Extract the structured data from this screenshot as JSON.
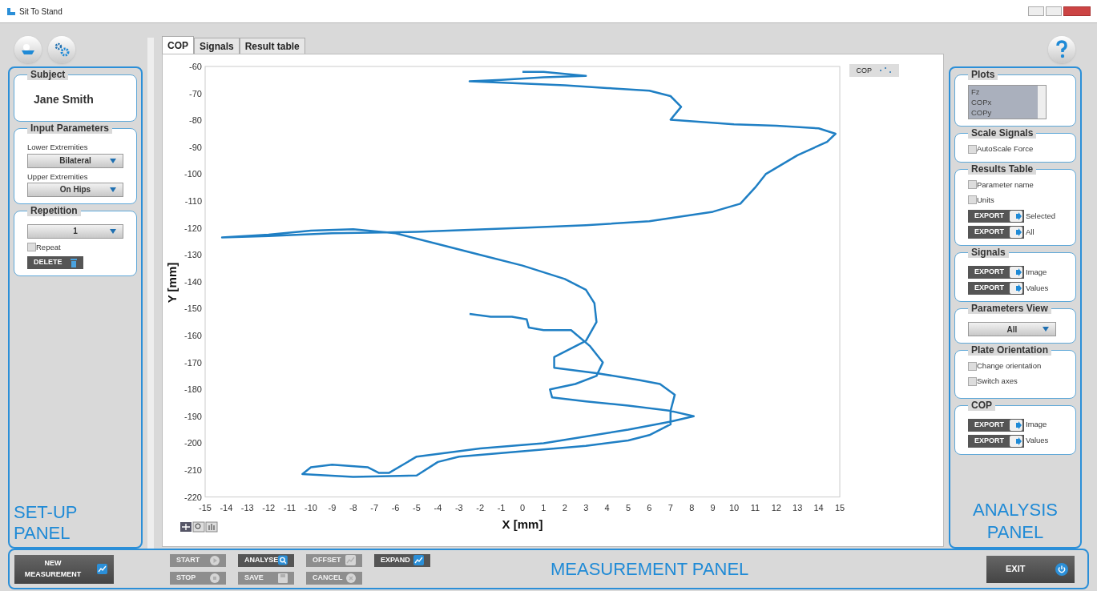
{
  "window": {
    "title": "Sit To Stand"
  },
  "setup_panel": {
    "label": "SET-UP PANEL",
    "subject": {
      "title": "Subject",
      "name": "Jane Smith"
    },
    "input_parameters": {
      "title": "Input Parameters",
      "fields": [
        {
          "label": "Lower Extremities",
          "value": "Bilateral"
        },
        {
          "label": "Upper Extremities",
          "value": "On Hips"
        }
      ]
    },
    "repetition": {
      "title": "Repetition",
      "value": "1",
      "repeat": {
        "label": "Repeat",
        "checked": false
      },
      "delete_button": "DELETE"
    }
  },
  "tabs": [
    {
      "label": "COP",
      "selected": true
    },
    {
      "label": "Signals",
      "selected": false
    },
    {
      "label": "Result table",
      "selected": false
    }
  ],
  "plot": {
    "chart_data": {
      "type": "line",
      "xlabel": "X [mm]",
      "ylabel": "Y [mm]",
      "xlim": [
        -15,
        15
      ],
      "ylim": [
        -220,
        -60
      ],
      "xticks": [
        -15,
        -14,
        -13,
        -12,
        -11,
        -10,
        -9,
        -8,
        -7,
        -6,
        -5,
        -4,
        -3,
        -2,
        -1,
        0,
        1,
        2,
        3,
        4,
        5,
        6,
        7,
        8,
        9,
        10,
        11,
        12,
        13,
        14,
        15
      ],
      "yticks": [
        -60,
        -70,
        -80,
        -90,
        -100,
        -110,
        -120,
        -130,
        -140,
        -150,
        -160,
        -170,
        -180,
        -190,
        -200,
        -210,
        -220
      ],
      "x": [
        -2.5,
        -1.5,
        -0.5,
        0.2,
        0.3,
        1,
        2.3,
        3.2,
        3.8,
        3.5,
        2.5,
        1.3,
        1.4,
        3,
        5,
        7,
        8.1,
        7,
        5,
        3,
        1,
        -2,
        -5,
        -6.3,
        -6.8,
        -7.3,
        -9,
        -10,
        -10.4,
        -8,
        -5,
        -4,
        -3,
        0,
        3,
        5,
        6,
        7,
        7,
        7.2,
        6.5,
        5.5,
        3.5,
        1.5,
        1.5,
        3,
        3.5,
        3.4,
        3,
        2,
        0,
        -2,
        -4,
        -6,
        -8,
        -10,
        -12,
        -14.2,
        -12,
        -9,
        -5,
        0,
        3,
        6,
        9,
        10.3,
        11,
        11.5,
        13,
        14.4,
        14.8,
        14,
        12,
        10,
        7,
        7.5,
        7,
        6,
        4,
        2,
        -2.5,
        -1,
        1,
        3,
        1,
        0
      ],
      "series": [
        {
          "name": "COP",
          "color": "#1f7fc4",
          "values": [
            -152,
            -153,
            -153,
            -154,
            -157,
            -158,
            -158,
            -164,
            -170,
            -175,
            -178,
            -180,
            -183,
            -184.5,
            -186,
            -188,
            -190,
            -192,
            -195,
            -197.5,
            -200,
            -202,
            -205,
            -211,
            -211,
            -209,
            -208,
            -209,
            -211.5,
            -212.5,
            -212,
            -207,
            -205,
            -203,
            -201,
            -199,
            -197,
            -193,
            -188,
            -182,
            -178,
            -176.5,
            -174,
            -172,
            -168,
            -162,
            -155,
            -148,
            -143,
            -139,
            -134,
            -130,
            -126,
            -122,
            -120.5,
            -121,
            -122.5,
            -123.5,
            -123,
            -122,
            -121.5,
            -120,
            -119,
            -117.5,
            -114,
            -111,
            -105,
            -100,
            -93,
            -88,
            -85,
            -83,
            -82,
            -81.5,
            -79.8,
            -75,
            -71,
            -69,
            -68,
            -67,
            -65.5,
            -65,
            -64,
            -63.5,
            -62,
            -62
          ]
        }
      ]
    }
  },
  "analysis_panel": {
    "label": "ANALYSIS PANEL",
    "plots": {
      "title": "Plots",
      "items": [
        {
          "label": "Fz",
          "selected": true
        },
        {
          "label": "COPx",
          "selected": true
        },
        {
          "label": "COPy",
          "selected": true
        }
      ]
    },
    "scale_signals": {
      "title": "Scale Signals",
      "options": [
        {
          "label": "AutoScale Force",
          "checked": false
        }
      ]
    },
    "results_table": {
      "title": "Results Table",
      "options": [
        {
          "label": "Parameter name",
          "checked": false
        },
        {
          "label": "Units",
          "checked": false
        }
      ],
      "exports": [
        {
          "button": "EXPORT",
          "label": "Selected"
        },
        {
          "button": "EXPORT",
          "label": "All"
        }
      ]
    },
    "signals": {
      "title": "Signals",
      "exports": [
        {
          "button": "EXPORT",
          "label": "Image"
        },
        {
          "button": "EXPORT",
          "label": "Values"
        }
      ]
    },
    "parameters_view": {
      "title": "Parameters View",
      "value": "All"
    },
    "plate_orientation": {
      "title": "Plate Orientation",
      "options": [
        {
          "label": "Change orientation",
          "checked": false
        },
        {
          "label": "Switch axes",
          "checked": false
        }
      ]
    },
    "cop": {
      "title": "COP",
      "exports": [
        {
          "button": "EXPORT",
          "label": "Image"
        },
        {
          "button": "EXPORT",
          "label": "Values"
        }
      ]
    }
  },
  "measurement_panel": {
    "label": "MEASUREMENT PANEL",
    "new_measurement": "NEW MEASUREMENT",
    "buttons": [
      {
        "label": "START",
        "kind": "play",
        "disabled": true
      },
      {
        "label": "ANALYSE",
        "kind": "analyse",
        "disabled": false
      },
      {
        "label": "OFFSET",
        "kind": "chart",
        "disabled": true
      },
      {
        "label": "EXPAND",
        "kind": "chart",
        "disabled": false
      },
      {
        "label": "STOP",
        "kind": "stop",
        "disabled": true
      },
      {
        "label": "SAVE",
        "kind": "save",
        "disabled": true
      },
      {
        "label": "CANCEL",
        "kind": "cancel",
        "disabled": true
      }
    ],
    "exit": "EXIT"
  }
}
